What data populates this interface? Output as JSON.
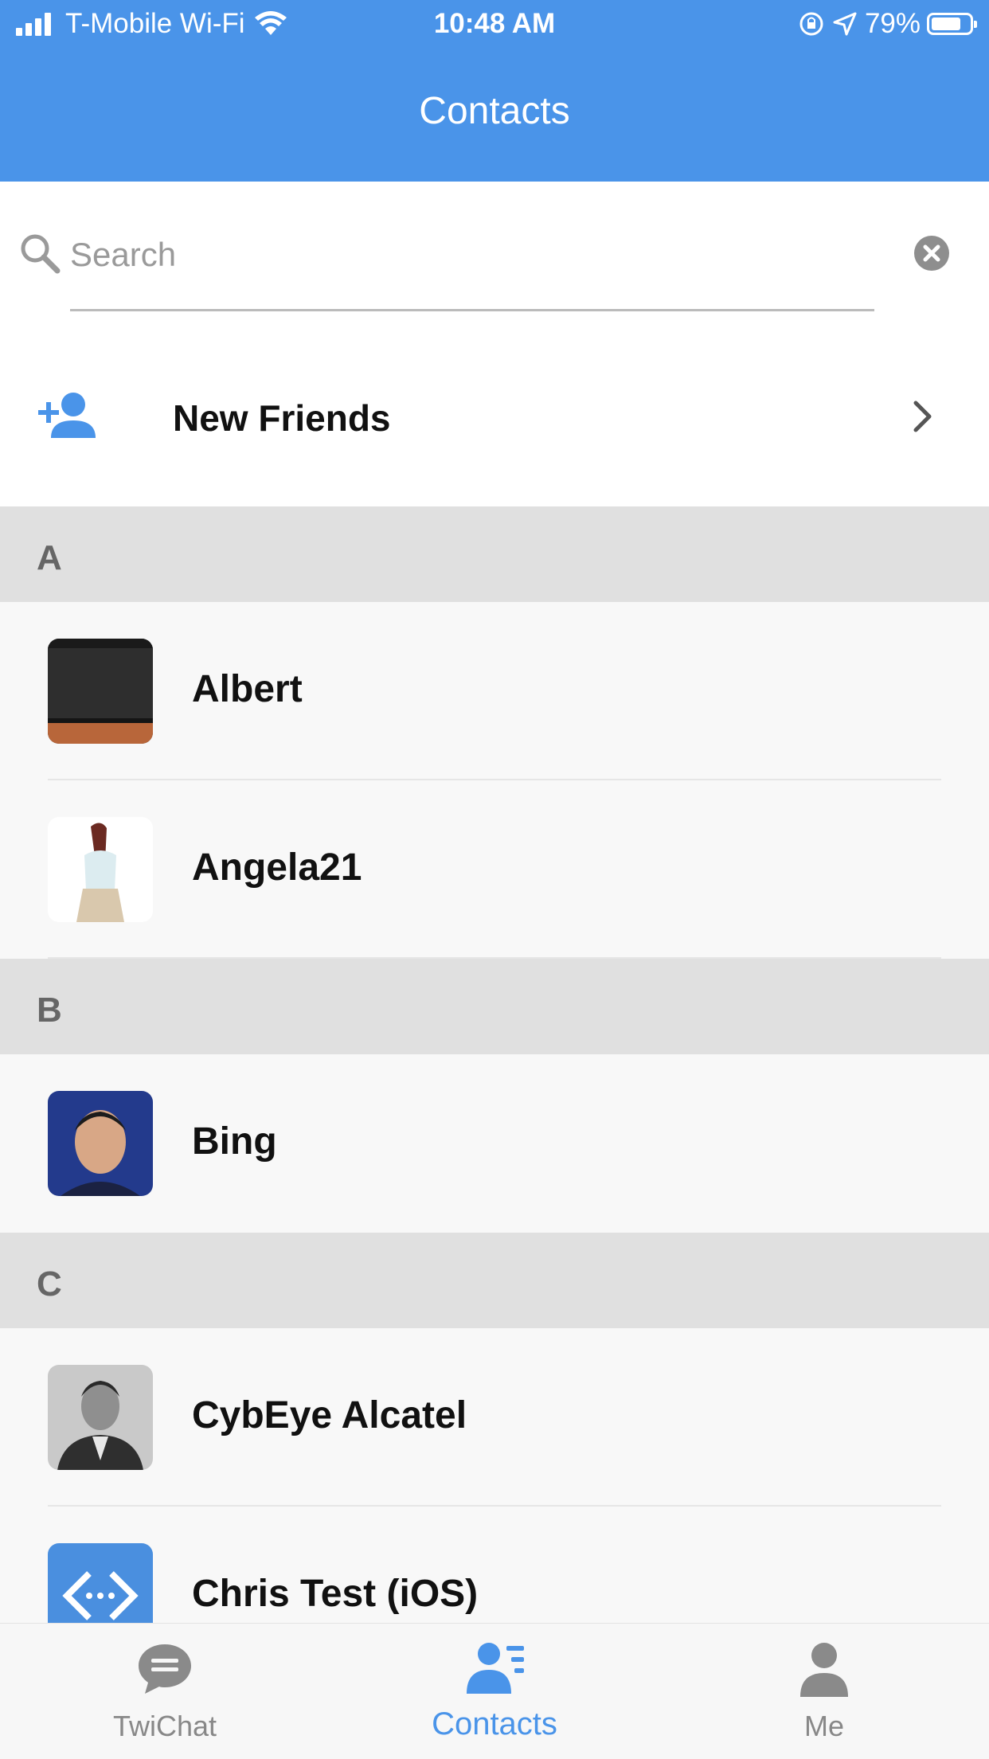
{
  "status_bar": {
    "carrier": "T-Mobile Wi-Fi",
    "time": "10:48 AM",
    "battery": "79%",
    "battery_level": 0.79
  },
  "header": {
    "title": "Contacts"
  },
  "search": {
    "placeholder": "Search",
    "value": ""
  },
  "new_friends": {
    "label": "New Friends"
  },
  "sections": {
    "a": {
      "letter": "A"
    },
    "b": {
      "letter": "B"
    },
    "c": {
      "letter": "C"
    }
  },
  "contacts": [
    {
      "name": "Albert"
    },
    {
      "name": "Angela21"
    },
    {
      "name": "Bing"
    },
    {
      "name": "CybEye Alcatel"
    },
    {
      "name": "Chris Test (iOS)"
    }
  ],
  "tabs": [
    {
      "label": "TwiChat",
      "icon": "chat-bubble-icon"
    },
    {
      "label": "Contacts",
      "icon": "contacts-icon",
      "active": true
    },
    {
      "label": "Me",
      "icon": "person-icon"
    }
  ],
  "colors": {
    "accent": "#4a94e9",
    "section_bg": "#e0e0e0",
    "tab_inactive": "#888888"
  }
}
